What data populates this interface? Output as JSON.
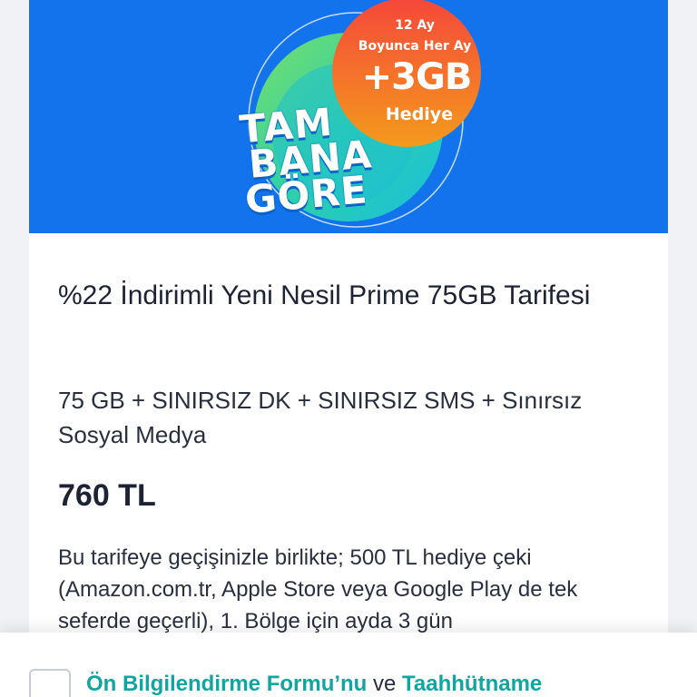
{
  "banner": {
    "badge_line1": "12 Ay",
    "badge_line2": "Boyunca Her Ay",
    "badge_line3": "+3GB",
    "badge_line4": "Hediye",
    "word1": "TAM",
    "word2": "BANA",
    "word3": "GÖRE",
    "colors": {
      "background": "#1273ec",
      "badge": "#f26a1b",
      "ring_green": "#4fd27a",
      "ring_teal": "#1fc4c9"
    }
  },
  "plan": {
    "title": "%22 İndirimli Yeni Nesil Prime 75GB Tarifesi",
    "features": "75 GB + SINIRSIZ DK + SINIRSIZ SMS + Sınırsız Sosyal Medya",
    "price": "760 TL",
    "description": " Bu tarifeye geçişinizle birlikte; 500 TL hediye çeki (Amazon.com.tr, Apple Store veya Google Play de tek seferde geçerli), 1. Bölge için ayda 3 gün"
  },
  "consent": {
    "link1": "Ön Bilgilendirme Formu’nu",
    "connector": " ve ",
    "link2": "Taahhütname",
    "link_color": "#0fa6a0"
  }
}
